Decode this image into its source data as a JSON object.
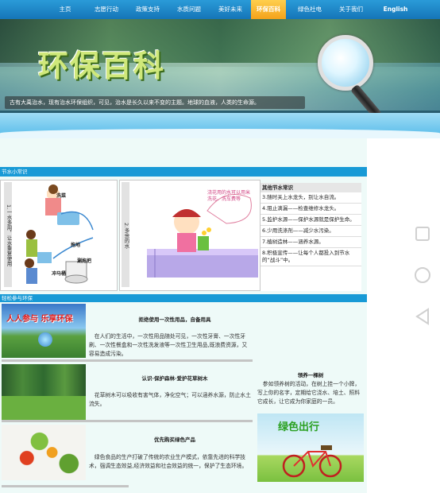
{
  "nav": {
    "items": [
      "主页",
      "志愿行动",
      "政策支持",
      "水质问题",
      "美好未来",
      "环保百科",
      "绿色社电",
      "关于我们",
      "English"
    ],
    "active": "环保百科"
  },
  "banner": {
    "title": "环保百科",
    "caption": "古有大禹治水，现有治水环保组织，可见，治水是长久以来不变的主题。地球的血液，人类的生命源。"
  },
  "section1": {
    "header": "节水小常识",
    "panel1_label": "1.一水多用，让水重复使用",
    "panel1_items": [
      "洗菜",
      "拖地",
      "冲马桶",
      "涮拖把"
    ],
    "panel2_label": "2.多余的水",
    "panel2_bubble": "浇花用的水可以用米洗花、洗车费等",
    "tips_title": "其他节水常识",
    "tips": [
      "3.随时关上水龙头，别让水自流。",
      "4.阻止滴漏——检查维修水龙头。",
      "5.监护水源——保护水源就是保护生命。",
      "6.少用洗涤剂——减少水污染。",
      "7.植树造林——涵养水源。",
      "8.积极宣传——让每个人都投入到节水的“战斗”中。"
    ]
  },
  "section2": {
    "header": "轻松参与环保",
    "cards": [
      {
        "title": "拒绝使用一次性用品，自备用具",
        "text": "在人们的生活中，一次性用品随处可见，一次性牙膏、一次性牙刷、一次性餐盒和一次性洗发液等一次性卫生用品,既浪费资源，又容易造成污染。",
        "img_text": "人人参与  乐享环保"
      },
      {
        "title": "认识·保护森林·爱护花草树木",
        "text": "花草树木可以吸收有害气体，净化空气；可以涵养水源，防止水土流失。"
      },
      {
        "title": "优先购买绿色产品",
        "text": "绿色食品的生产打破了传统的农业生产模式，依靠先进的科学技术，强调生态效益,经济效益和社会效益的统一，保护了生态环境。"
      }
    ],
    "side_title": "领养一棵树",
    "side_text": "参如领养树的活动，在树上挂一个小牌，写上你的名字，定期给它浇水、培土、照料它成长，让它成为你家庭的一员。",
    "side_img_text": "绿色出行"
  },
  "colors": {
    "nav": "#1e88c9",
    "active": "#f4a21b",
    "section": "#189ad6",
    "bg": "#eefaf8"
  }
}
